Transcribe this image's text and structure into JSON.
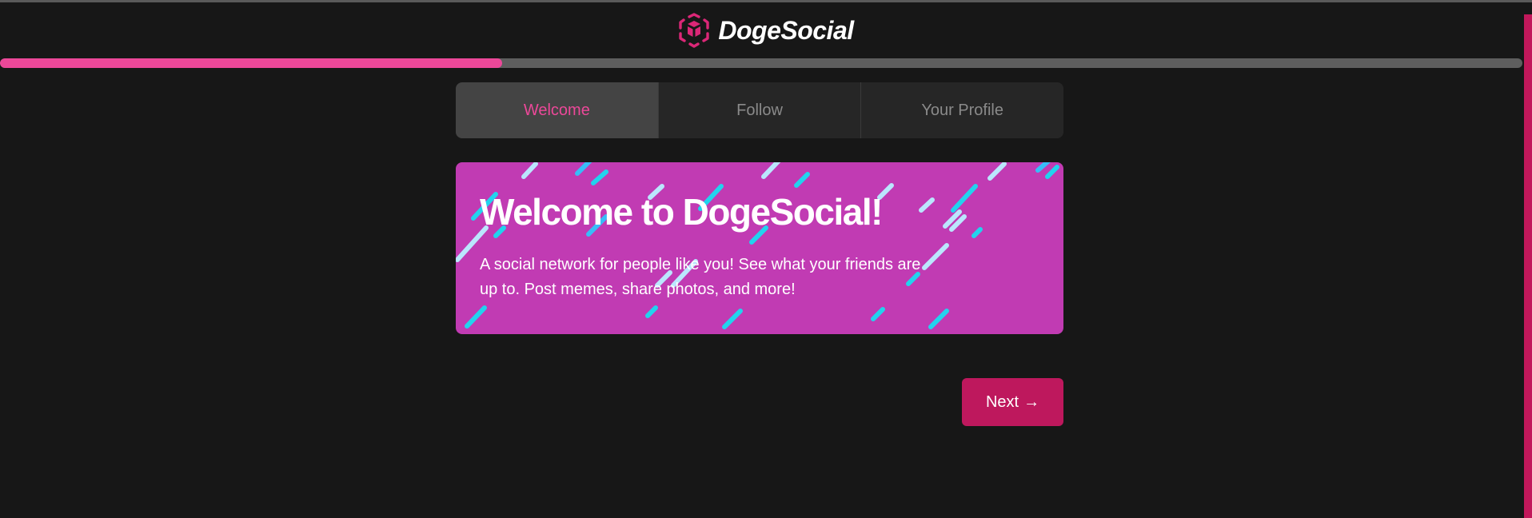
{
  "app": {
    "brand_name": "DogeSocial",
    "logo_icon": "hexagon-cube-icon",
    "accent_color": "#ec4899"
  },
  "progress": {
    "fraction": 0.33
  },
  "tabs": [
    {
      "label": "Welcome",
      "active": true
    },
    {
      "label": "Follow",
      "active": false
    },
    {
      "label": "Your Profile",
      "active": false
    }
  ],
  "hero": {
    "title": "Welcome to DogeSocial!",
    "description": "A social network for people like you! See what your friends are up to. Post memes, share photos, and more!",
    "background_color": "#c13bb3"
  },
  "actions": {
    "next_label": "Next",
    "next_icon": "arrow-right-icon"
  }
}
